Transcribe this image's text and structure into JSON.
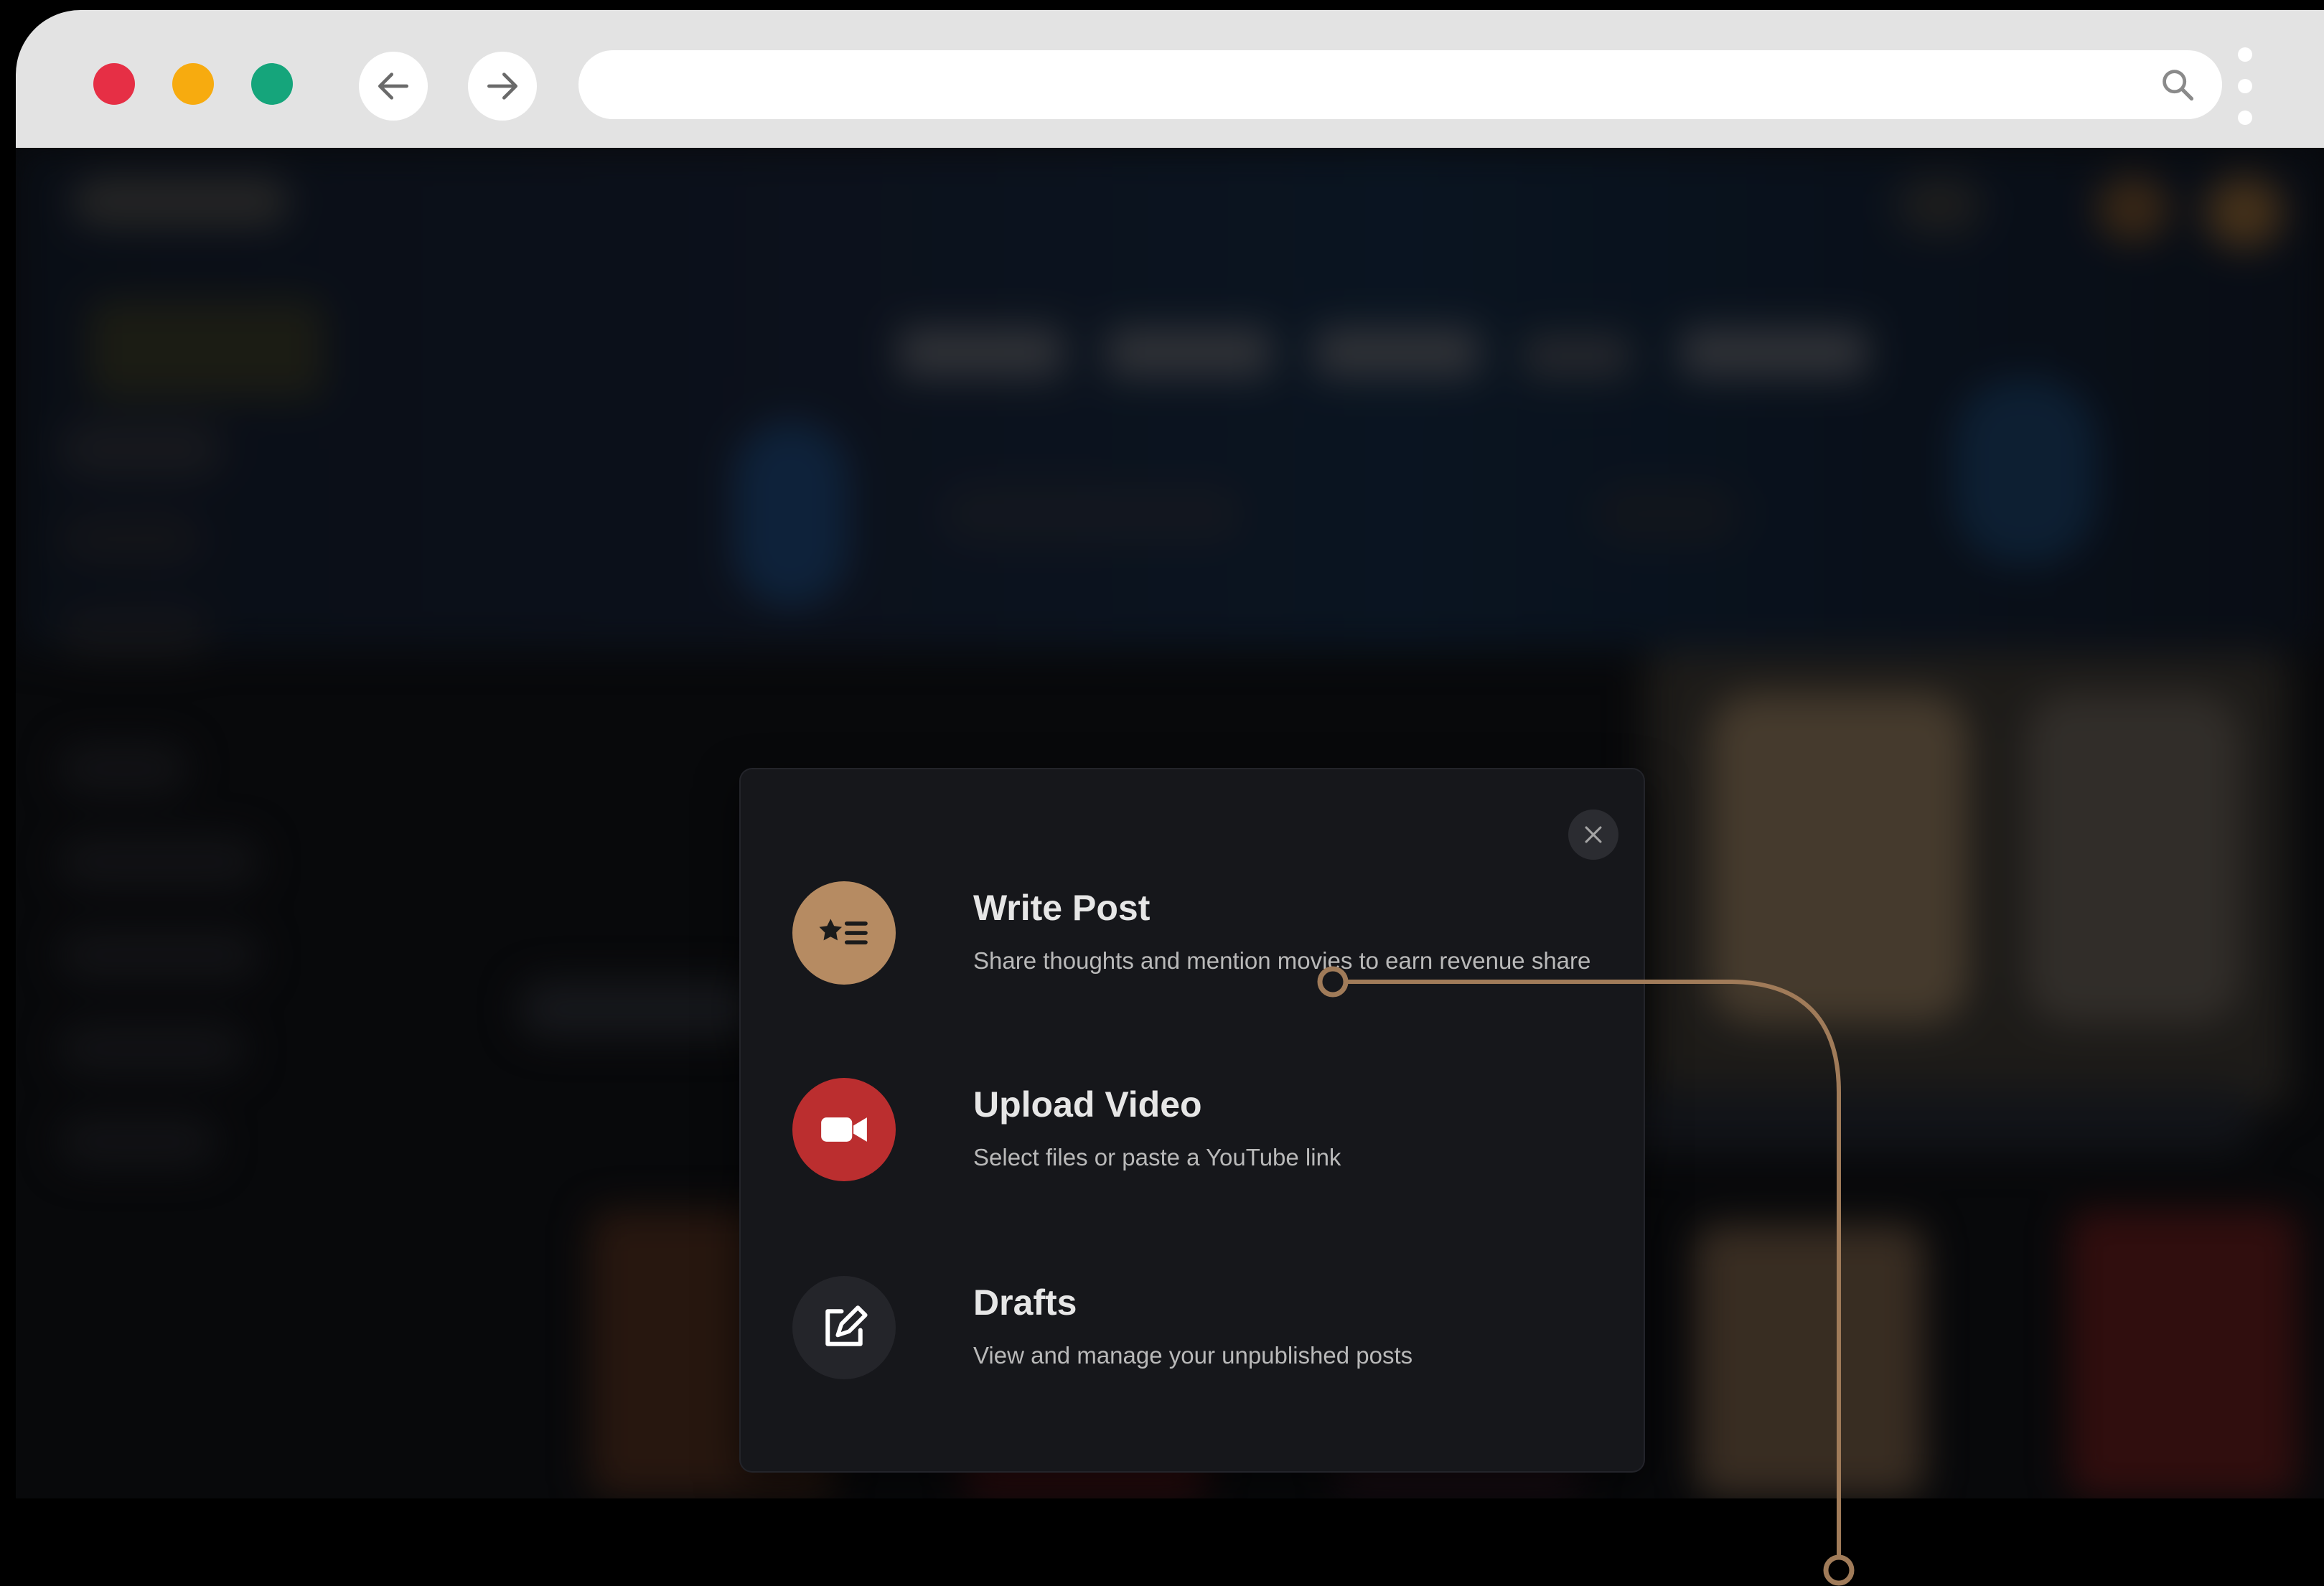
{
  "browser": {
    "url": "",
    "colors": {
      "close": "#e62f45",
      "minimize": "#f7ab0f",
      "maximize": "#15a57b",
      "chrome": "#e3e3e3"
    }
  },
  "modal": {
    "options": [
      {
        "title": "Write Post",
        "description": "Share thoughts and mention movies to earn revenue share",
        "icon": "star-list-icon",
        "icon_bg": "#b68b62"
      },
      {
        "title": "Upload Video",
        "description": "Select files or paste a YouTube link",
        "icon": "video-camera-icon",
        "icon_bg": "#bb2e2f"
      },
      {
        "title": "Drafts",
        "description": "View and manage your unpublished posts",
        "icon": "edit-square-icon",
        "icon_bg": "#24252a"
      }
    ]
  },
  "callout": {
    "color": "#a07b59"
  }
}
